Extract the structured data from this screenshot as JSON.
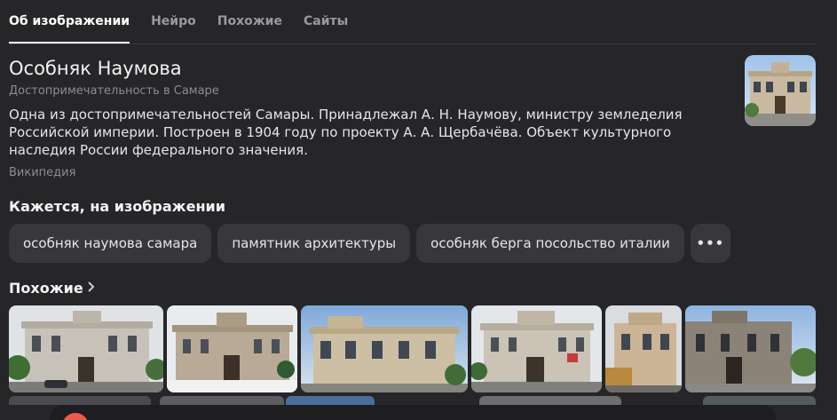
{
  "tabs": [
    {
      "label": "Об изображении",
      "active": true
    },
    {
      "label": "Нейро",
      "active": false
    },
    {
      "label": "Похожие",
      "active": false
    },
    {
      "label": "Сайты",
      "active": false
    }
  ],
  "entity": {
    "title": "Особняк Наумова",
    "subtitle": "Достопримечательность в Самаре",
    "description": "Одна из достопримечательностей Самары. Принадлежал А. Н. Наумову, министру земледелия Российской империи. Построен в 1904 году по проекту А. А. Щербачёва. Объект культурного наследия России федерального значения.",
    "source": "Википедия"
  },
  "seems": {
    "heading": "Кажется, на изображении",
    "chips": [
      "особняк наумова самара",
      "памятник архитектуры",
      "особняк берга посольство италии"
    ],
    "more_label": "•••"
  },
  "similar": {
    "heading": "Похожие"
  },
  "colors": {
    "background": "#262528",
    "chip": "#38373b",
    "accent": "#e85b4d"
  }
}
